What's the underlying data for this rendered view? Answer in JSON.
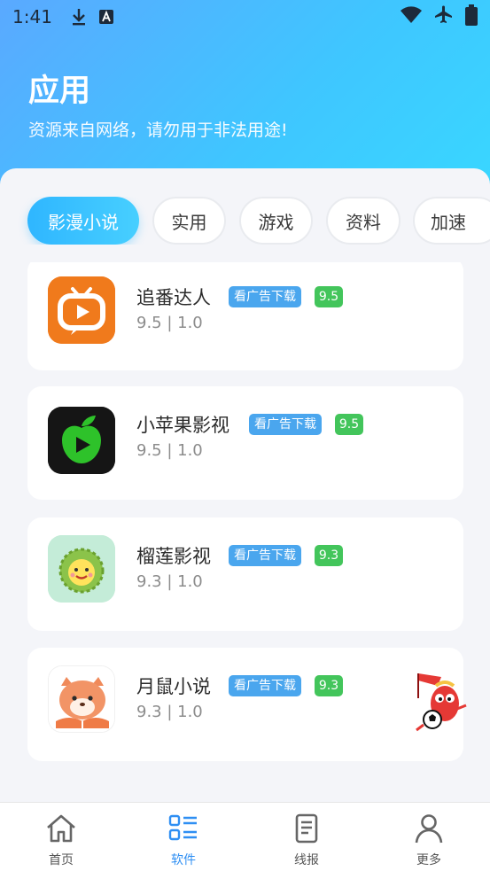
{
  "status": {
    "time": "1:41",
    "left_icons": [
      "download-icon",
      "a-badge-icon"
    ],
    "right_icons": [
      "wifi-icon",
      "airplane-icon",
      "battery-icon"
    ]
  },
  "header": {
    "title": "应用",
    "subtitle": "资源来自网络，请勿用于非法用途!"
  },
  "tabs": [
    {
      "label": "影漫小说",
      "active": true
    },
    {
      "label": "实用",
      "active": false
    },
    {
      "label": "游戏",
      "active": false
    },
    {
      "label": "资料",
      "active": false
    },
    {
      "label": "加速",
      "active": false
    }
  ],
  "apps": [
    {
      "name": "追番达人",
      "ad_badge": "看广告下载",
      "score": "9.5",
      "meta": "9.5 | 1.0",
      "icon": "tv-play-icon"
    },
    {
      "name": "小苹果影视",
      "ad_badge": "看广告下载",
      "score": "9.5",
      "meta": "9.5 | 1.0",
      "icon": "apple-play-icon"
    },
    {
      "name": "榴莲影视",
      "ad_badge": "看广告下载",
      "score": "9.3",
      "meta": "9.3 | 1.0",
      "icon": "durian-icon"
    },
    {
      "name": "月鼠小说",
      "ad_badge": "看广告下载",
      "score": "9.3",
      "meta": "9.3 | 1.0",
      "icon": "hamster-book-icon"
    }
  ],
  "bottom_nav": [
    {
      "label": "首页",
      "icon": "home-icon",
      "active": false
    },
    {
      "label": "软件",
      "icon": "apps-list-icon",
      "active": true
    },
    {
      "label": "线报",
      "icon": "document-icon",
      "active": false
    },
    {
      "label": "更多",
      "icon": "user-icon",
      "active": false
    }
  ],
  "colors": {
    "accent": "#3fc6ff",
    "ad_badge": "#4aa6ee",
    "score_badge": "#43c55b",
    "nav_active": "#2f8ff3"
  }
}
